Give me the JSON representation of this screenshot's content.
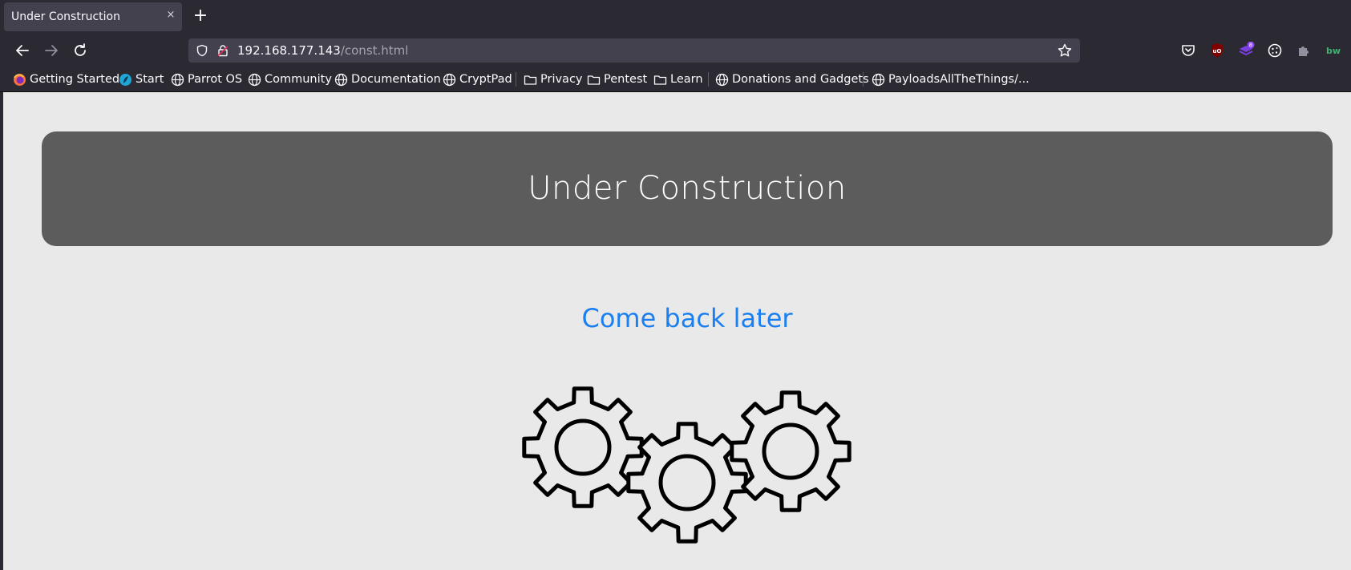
{
  "browser": {
    "tab": {
      "title": "Under Construction",
      "close_glyph": "×"
    },
    "new_tab_glyph": "+",
    "nav": {
      "back_icon": "arrow-left-icon",
      "forward_icon": "arrow-right-icon",
      "reload_icon": "reload-icon"
    },
    "url": {
      "host": "192.168.177.143",
      "path": "/const.html"
    },
    "extensions": [
      {
        "name": "pocket-icon"
      },
      {
        "name": "ublock-origin-icon"
      },
      {
        "name": "multi-extension-icon",
        "badge": "8"
      },
      {
        "name": "cookie-icon"
      },
      {
        "name": "extensions-puzzle-icon"
      },
      {
        "name": "bitwarden-icon",
        "text": "bw"
      }
    ],
    "bookmarks": [
      {
        "label": "Getting Started",
        "icon": "firefox-icon"
      },
      {
        "label": "Start",
        "icon": "parrot-icon"
      },
      {
        "label": "Parrot OS",
        "icon": "globe-icon"
      },
      {
        "label": "Community",
        "icon": "globe-icon"
      },
      {
        "label": "Documentation",
        "icon": "globe-icon"
      },
      {
        "label": "CryptPad",
        "icon": "globe-icon"
      },
      {
        "label": "Privacy",
        "icon": "folder-icon"
      },
      {
        "label": "Pentest",
        "icon": "folder-icon"
      },
      {
        "label": "Learn",
        "icon": "folder-icon"
      },
      {
        "label": "Donations and Gadgets",
        "icon": "globe-icon"
      },
      {
        "label": "PayloadsAllTheThings/...",
        "icon": "globe-icon"
      }
    ]
  },
  "page": {
    "header_title": "Under Construction",
    "subtitle": "Come back later",
    "illustration": "gears-icon",
    "colors": {
      "background": "#e9e9e9",
      "header_box": "#5c5c5c",
      "header_text": "#ffffff",
      "subtitle": "#1a7ff0"
    }
  }
}
